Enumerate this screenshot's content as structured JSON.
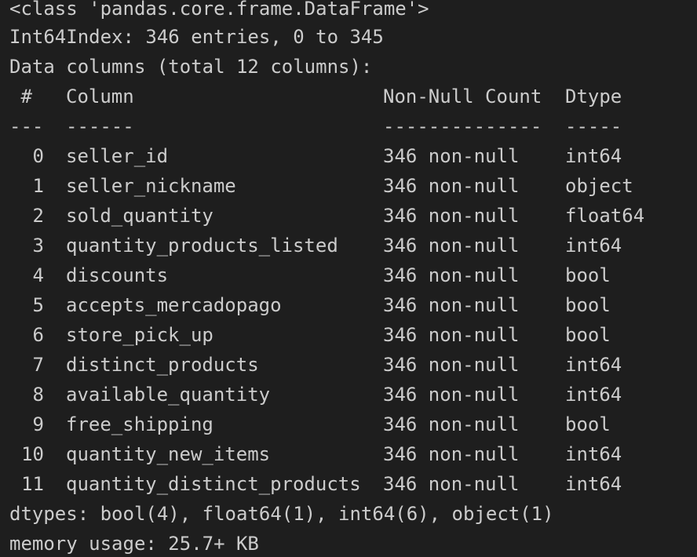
{
  "header": {
    "class_line": "<class 'pandas.core.frame.DataFrame'>",
    "index_line": "Int64Index: 346 entries, 0 to 345",
    "columns_line": "Data columns (total 12 columns):"
  },
  "table": {
    "headers": {
      "index": " #",
      "column": "Column",
      "non_null": "Non-Null Count",
      "dtype": "Dtype"
    },
    "separators": {
      "index": "---",
      "column": "------",
      "non_null": "--------------",
      "dtype": "-----"
    },
    "rows": [
      {
        "index": "0",
        "column": "seller_id",
        "non_null": "346 non-null",
        "dtype": "int64"
      },
      {
        "index": "1",
        "column": "seller_nickname",
        "non_null": "346 non-null",
        "dtype": "object"
      },
      {
        "index": "2",
        "column": "sold_quantity",
        "non_null": "346 non-null",
        "dtype": "float64"
      },
      {
        "index": "3",
        "column": "quantity_products_listed",
        "non_null": "346 non-null",
        "dtype": "int64"
      },
      {
        "index": "4",
        "column": "discounts",
        "non_null": "346 non-null",
        "dtype": "bool"
      },
      {
        "index": "5",
        "column": "accepts_mercadopago",
        "non_null": "346 non-null",
        "dtype": "bool"
      },
      {
        "index": "6",
        "column": "store_pick_up",
        "non_null": "346 non-null",
        "dtype": "bool"
      },
      {
        "index": "7",
        "column": "distinct_products",
        "non_null": "346 non-null",
        "dtype": "int64"
      },
      {
        "index": "8",
        "column": "available_quantity",
        "non_null": "346 non-null",
        "dtype": "int64"
      },
      {
        "index": "9",
        "column": "free_shipping",
        "non_null": "346 non-null",
        "dtype": "bool"
      },
      {
        "index": "10",
        "column": "quantity_new_items",
        "non_null": "346 non-null",
        "dtype": "int64"
      },
      {
        "index": "11",
        "column": "quantity_distinct_products",
        "non_null": "346 non-null",
        "dtype": "int64"
      }
    ]
  },
  "footer": {
    "dtypes_line": "dtypes: bool(4), float64(1), int64(6), object(1)",
    "memory_line": "memory usage: 25.7+ KB"
  }
}
